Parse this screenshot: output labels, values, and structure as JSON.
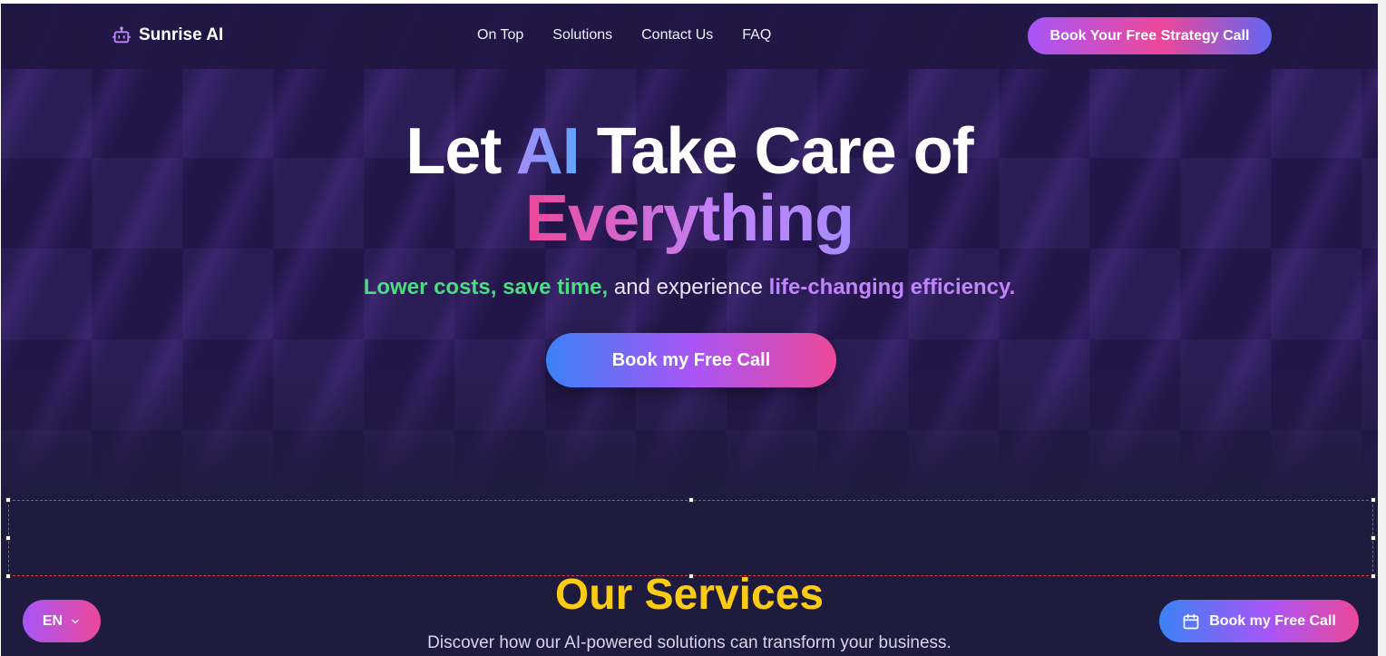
{
  "brand": {
    "name": "Sunrise AI",
    "icon": "robot-icon"
  },
  "nav": {
    "links": [
      "On Top",
      "Solutions",
      "Contact Us",
      "FAQ"
    ],
    "cta_label": "Book Your Free Strategy Call"
  },
  "hero": {
    "headline_part1": "Let ",
    "headline_highlight": "AI",
    "headline_part2": " Take Care of",
    "headline_line2": "Everything",
    "sub_green": "Lower costs, save time,",
    "sub_plain": " and experience ",
    "sub_purple": "life-changing efficiency.",
    "cta_label": "Book my Free Call"
  },
  "services": {
    "title": "Our Services",
    "subtitle": "Discover how our AI-powered solutions can transform your business."
  },
  "floating": {
    "language_label": "EN",
    "language_icon": "chevron-down-icon",
    "cta_label": "Book my Free Call",
    "cta_icon": "calendar-icon"
  },
  "colors": {
    "background": "#1f1b3f",
    "accent_yellow": "#facc15",
    "accent_green": "#4ade80",
    "accent_purple": "#c084fc",
    "accent_pink": "#ec4899",
    "selection_border": "#e03a3a"
  }
}
